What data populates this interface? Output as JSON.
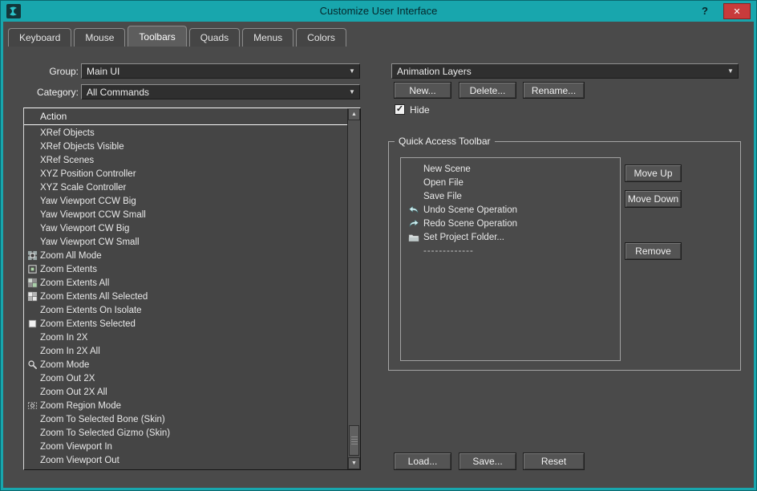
{
  "window": {
    "title": "Customize User Interface",
    "help_label": "?",
    "close_glyph": "✕"
  },
  "tabs": [
    {
      "label": "Keyboard",
      "active": false
    },
    {
      "label": "Mouse",
      "active": false
    },
    {
      "label": "Toolbars",
      "active": true
    },
    {
      "label": "Quads",
      "active": false
    },
    {
      "label": "Menus",
      "active": false
    },
    {
      "label": "Colors",
      "active": false
    }
  ],
  "left": {
    "group_label": "Group:",
    "group_value": "Main UI",
    "category_label": "Category:",
    "category_value": "All Commands",
    "list_header": "Action",
    "actions": [
      {
        "label": "XRef Objects"
      },
      {
        "label": "XRef Objects Visible"
      },
      {
        "label": "XRef Scenes"
      },
      {
        "label": "XYZ Position Controller"
      },
      {
        "label": "XYZ Scale Controller"
      },
      {
        "label": "Yaw Viewport CCW Big"
      },
      {
        "label": "Yaw Viewport CCW Small"
      },
      {
        "label": "Yaw Viewport CW Big"
      },
      {
        "label": "Yaw Viewport CW Small"
      },
      {
        "label": "Zoom All Mode",
        "icon": "zoom-all-mode-icon"
      },
      {
        "label": "Zoom Extents",
        "icon": "zoom-extents-icon"
      },
      {
        "label": "Zoom Extents All",
        "icon": "zoom-extents-all-icon"
      },
      {
        "label": "Zoom Extents All Selected",
        "icon": "zoom-extents-all-selected-icon"
      },
      {
        "label": "Zoom Extents On Isolate"
      },
      {
        "label": "Zoom Extents Selected",
        "icon": "zoom-extents-selected-icon"
      },
      {
        "label": "Zoom In 2X"
      },
      {
        "label": "Zoom In 2X All"
      },
      {
        "label": "Zoom Mode",
        "icon": "zoom-mode-icon"
      },
      {
        "label": "Zoom Out 2X"
      },
      {
        "label": "Zoom Out 2X All"
      },
      {
        "label": "Zoom Region Mode",
        "icon": "zoom-region-mode-icon"
      },
      {
        "label": "Zoom To Selected Bone (Skin)"
      },
      {
        "label": "Zoom To Selected Gizmo (Skin)"
      },
      {
        "label": "Zoom Viewport In"
      },
      {
        "label": "Zoom Viewport Out"
      }
    ]
  },
  "right": {
    "toolbar_value": "Animation Layers",
    "new_label": "New...",
    "delete_label": "Delete...",
    "rename_label": "Rename...",
    "hide_label": "Hide",
    "hide_checked": true,
    "quick_access": {
      "title": "Quick Access Toolbar",
      "items": [
        {
          "label": "New Scene"
        },
        {
          "label": "Open File"
        },
        {
          "label": "Save File"
        },
        {
          "label": "Undo Scene Operation",
          "icon": "undo-icon"
        },
        {
          "label": "Redo Scene Operation",
          "icon": "redo-icon"
        },
        {
          "label": "Set Project Folder...",
          "icon": "folder-icon"
        },
        {
          "label": "-------------",
          "divider": true
        }
      ],
      "move_up_label": "Move Up",
      "move_down_label": "Move Down",
      "remove_label": "Remove"
    },
    "load_label": "Load...",
    "save_label": "Save...",
    "reset_label": "Reset"
  },
  "glyphs": {
    "up_arrow": "▲",
    "down_arrow": "▼",
    "combo_arrow": "▼",
    "check": "✓"
  },
  "colors": {
    "titlebar": "#18a6ad",
    "dialog_bg": "#4a4a4a",
    "close_button": "#c83b3b",
    "text": "#eeeeee"
  }
}
